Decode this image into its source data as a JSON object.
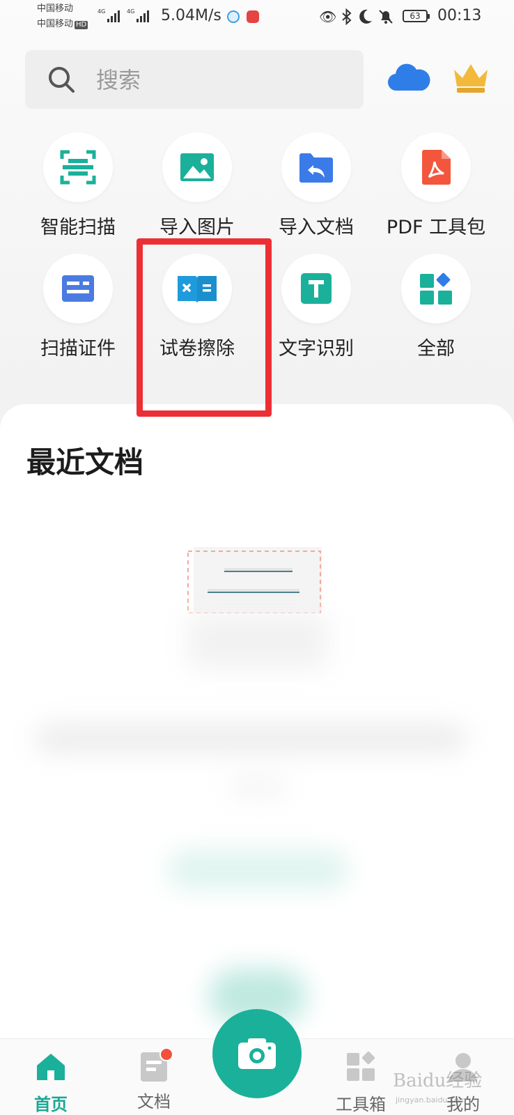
{
  "status_bar": {
    "carrier1": "中国移动",
    "carrier2": "中国移动",
    "hd": "HD",
    "net1": "4G",
    "net2": "4G",
    "speed": "5.04M/s",
    "battery": "63",
    "time": "00:13"
  },
  "search": {
    "placeholder": "搜索"
  },
  "features": [
    {
      "label": "智能扫描",
      "icon": "scan-icon",
      "color": "#1bb09a"
    },
    {
      "label": "导入图片",
      "icon": "image-icon",
      "color": "#1bb09a"
    },
    {
      "label": "导入文档",
      "icon": "folder-import-icon",
      "color": "#3b7be8"
    },
    {
      "label": "PDF 工具包",
      "icon": "pdf-icon",
      "color": "#f2573d"
    },
    {
      "label": "扫描证件",
      "icon": "id-card-icon",
      "color": "#4a7be0"
    },
    {
      "label": "试卷擦除",
      "icon": "exam-erase-icon",
      "color": "#1e9bdc"
    },
    {
      "label": "文字识别",
      "icon": "text-recognition-icon",
      "color": "#1bb09a"
    },
    {
      "label": "全部",
      "icon": "all-apps-icon",
      "color": "#1bb09a"
    }
  ],
  "recent": {
    "title": "最近文档"
  },
  "bottom_nav": {
    "home": "首页",
    "docs": "文档",
    "tools": "工具箱",
    "me": "我的"
  },
  "colors": {
    "accent": "#1bb09a",
    "highlight": "#ec2f35"
  },
  "watermark": {
    "text": "Baidu经验",
    "sub": "jingyan.baidu.com"
  }
}
